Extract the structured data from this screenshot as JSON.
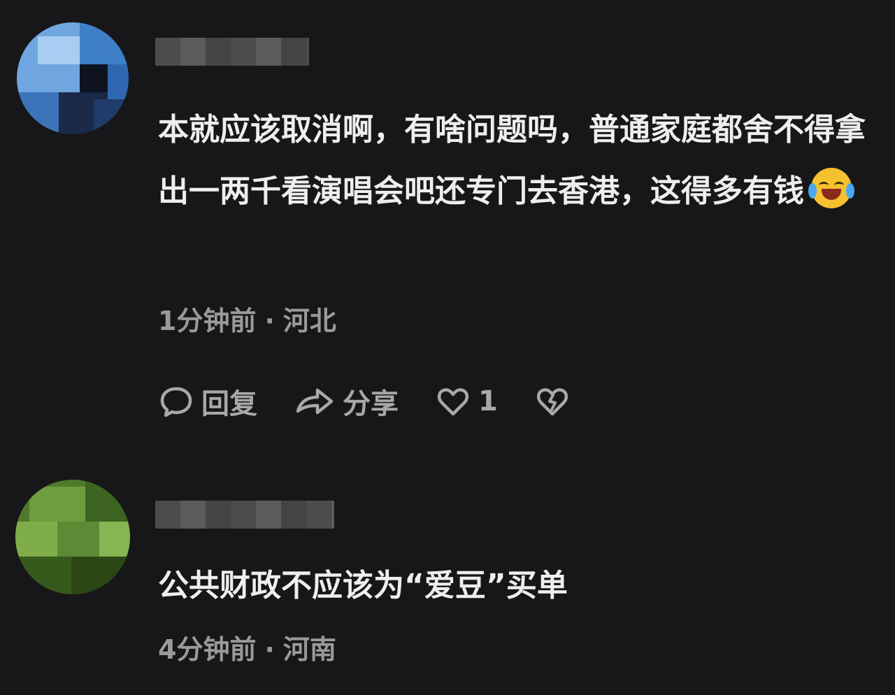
{
  "comments": [
    {
      "text": "本就应该取消啊，有啥问题吗，普通家庭都舍不得拿出一两千看演唱会吧还专门去香港，这得多有钱",
      "emoji": "crying-laughing-emoji",
      "time": "1分钟前",
      "location": "河北",
      "actions": {
        "reply_label": "回复",
        "share_label": "分享",
        "like_count": "1"
      }
    },
    {
      "text": "公共财政不应该为“爱豆”买单",
      "time": "4分钟前",
      "location": "河南"
    }
  ],
  "separator": "·",
  "colors": {
    "background": "#171719",
    "text": "#eeeeee",
    "meta": "#9a9a9c",
    "action": "#a8a8aa"
  },
  "icons": [
    "comment-bubble-icon",
    "share-arrow-icon",
    "heart-icon",
    "broken-heart-icon"
  ]
}
